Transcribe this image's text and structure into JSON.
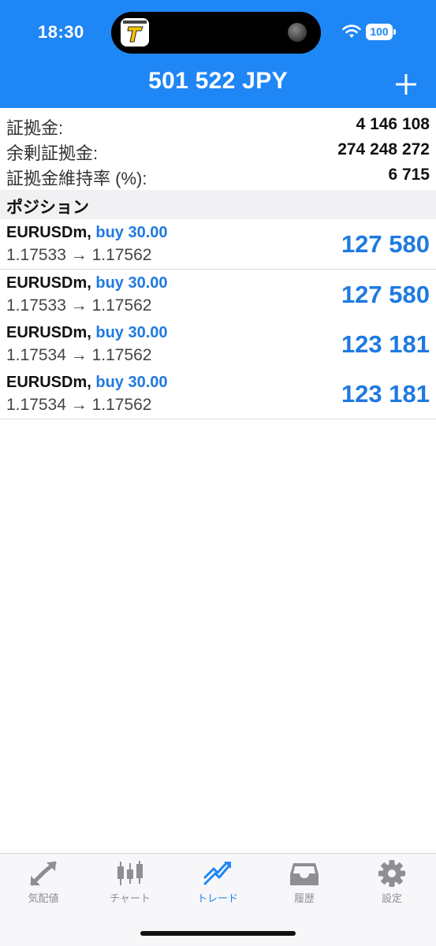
{
  "status_bar": {
    "time": "18:30",
    "battery": "100"
  },
  "header": {
    "title": "501 522 JPY"
  },
  "summary": {
    "clipped_label": "証拠金:",
    "rows": [
      {
        "label": "証拠金:",
        "value": "4 146 108"
      },
      {
        "label": "余剰証拠金:",
        "value": "274 248 272"
      },
      {
        "label": "証拠金維持率 (%):",
        "value": "6 715"
      }
    ]
  },
  "positions": {
    "section_title": "ポジション",
    "items": [
      {
        "symbol": "EURUSDm,",
        "side": "buy 30.00",
        "prices": "1.17533 → 1.17562",
        "profit": "127 580"
      },
      {
        "symbol": "EURUSDm,",
        "side": "buy 30.00",
        "prices": "1.17533 → 1.17562",
        "profit": "127 580"
      },
      {
        "symbol": "EURUSDm,",
        "side": "buy 30.00",
        "prices": "1.17534 → 1.17562",
        "profit": "123 181"
      },
      {
        "symbol": "EURUSDm,",
        "side": "buy 30.00",
        "prices": "1.17534 → 1.17562",
        "profit": "123 181"
      }
    ]
  },
  "tabbar": {
    "tabs": [
      {
        "label": "気配値",
        "icon": "quotes-icon",
        "active": false
      },
      {
        "label": "チャート",
        "icon": "chart-icon",
        "active": false
      },
      {
        "label": "トレード",
        "icon": "trade-icon",
        "active": true
      },
      {
        "label": "履歴",
        "icon": "history-icon",
        "active": false
      },
      {
        "label": "設定",
        "icon": "settings-icon",
        "active": false
      }
    ]
  },
  "colors": {
    "header_bg": "#1f86f5",
    "accent_blue": "#1f7ae0",
    "tab_inactive": "#8e8e93"
  }
}
